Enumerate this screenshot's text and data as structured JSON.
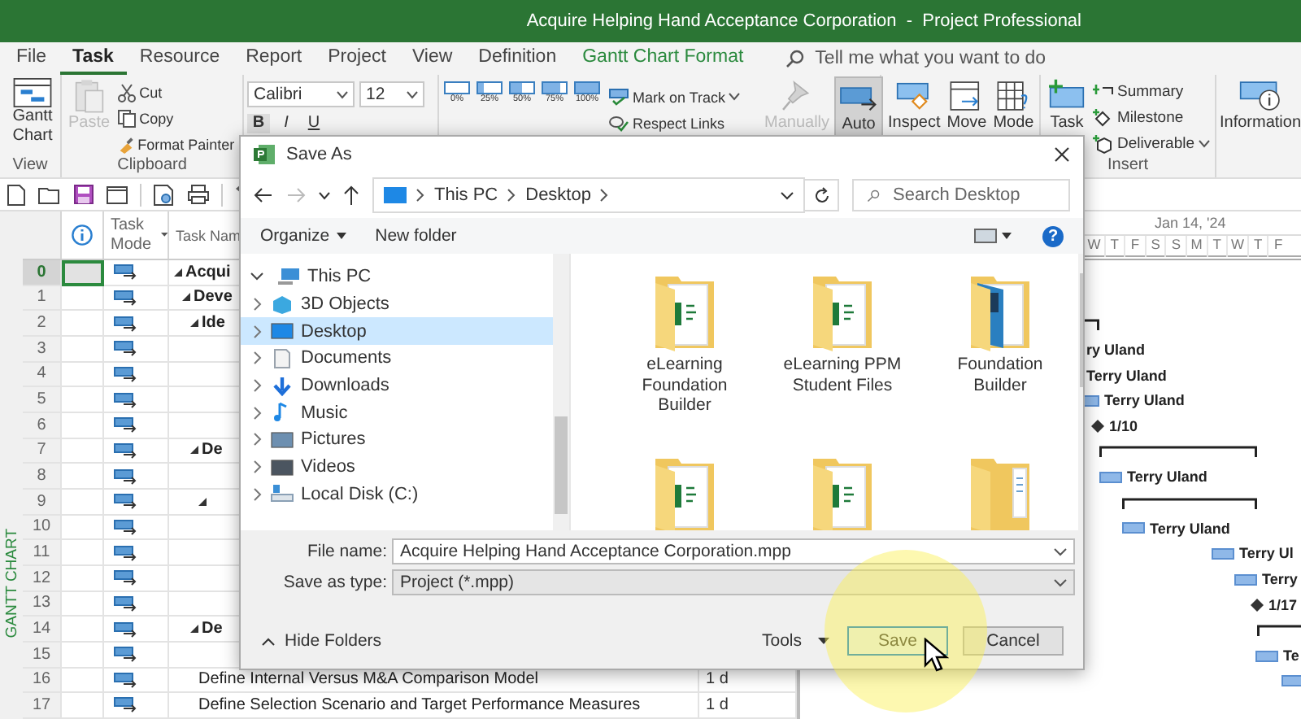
{
  "window": {
    "title": "Acquire Helping Hand Acceptance Corporation  -  Project Professional"
  },
  "menu_tabs": [
    {
      "label": "File",
      "selected": false,
      "kind": "plain"
    },
    {
      "label": "Task",
      "selected": true,
      "kind": "plain"
    },
    {
      "label": "Resource",
      "selected": false,
      "kind": "plain"
    },
    {
      "label": "Report",
      "selected": false,
      "kind": "plain"
    },
    {
      "label": "Project",
      "selected": false,
      "kind": "plain"
    },
    {
      "label": "View",
      "selected": false,
      "kind": "plain"
    },
    {
      "label": "Definition",
      "selected": false,
      "kind": "plain"
    },
    {
      "label": "Gantt Chart Format",
      "selected": false,
      "kind": "contextual"
    }
  ],
  "search": {
    "placeholder": "Tell me what you want to do"
  },
  "ribbon": {
    "view": {
      "button": "Gantt Chart",
      "label": "View"
    },
    "clipboard": {
      "paste": {
        "label": "Paste",
        "disabled": true
      },
      "cut": "Cut",
      "copy": "Copy",
      "format_painter": "Format Painter",
      "label": "Clipboard"
    },
    "font": {
      "name": "Calibri",
      "size": "12",
      "format_buttons": [
        "B",
        "I",
        "U"
      ]
    },
    "schedule": {
      "percent_buttons": [
        "0%",
        "25%",
        "50%",
        "75%",
        "100%"
      ],
      "mark_on_track": "Mark on Track",
      "respect_links": "Respect Links"
    },
    "tasks": [
      {
        "label": "Manually",
        "disabled": true,
        "selected": false
      },
      {
        "label": "Auto",
        "disabled": false,
        "selected": true
      }
    ],
    "task_tools": [
      "Inspect",
      "Move",
      "Mode"
    ],
    "insert": {
      "task": "Task",
      "summary": "Summary",
      "milestone": "Milestone",
      "deliverable": "Deliverable",
      "label": "Insert"
    },
    "properties": {
      "information": "Information"
    }
  },
  "grid": {
    "side_label": "GANTT CHART",
    "columns": [
      "Task Mode",
      "Task Nam"
    ],
    "rows": [
      {
        "id": "0",
        "name": "Acqui",
        "selected": true,
        "expanded": true,
        "children": [
          {
            "id": "1",
            "name": "Deve",
            "selected": false,
            "expanded": true,
            "children": [
              {
                "id": "2",
                "name": "Ide",
                "selected": false,
                "expanded": true,
                "children": [
                  {
                    "id": "3",
                    "selected": false
                  },
                  {
                    "id": "4",
                    "selected": false
                  },
                  {
                    "id": "5",
                    "selected": false
                  },
                  {
                    "id": "6",
                    "selected": false
                  }
                ]
              },
              {
                "id": "7",
                "name": "De",
                "selected": false,
                "expanded": true,
                "children": [
                  {
                    "id": "8",
                    "selected": false
                  },
                  {
                    "id": "9",
                    "selected": false,
                    "expanded": true,
                    "children": [
                      {
                        "id": "10",
                        "selected": false
                      },
                      {
                        "id": "11",
                        "selected": false
                      },
                      {
                        "id": "12",
                        "selected": false
                      },
                      {
                        "id": "13",
                        "selected": false
                      }
                    ]
                  }
                ]
              },
              {
                "id": "14",
                "name": "De",
                "selected": false,
                "expanded": true,
                "children": [
                  {
                    "id": "15",
                    "selected": false
                  },
                  {
                    "id": "16",
                    "name": "Define Internal Versus M&A Comparison Model",
                    "duration": "1 d",
                    "selected": false
                  },
                  {
                    "id": "17",
                    "name": "Define Selection Scenario and Target Performance Measures",
                    "duration": "1 d",
                    "selected": false
                  }
                ]
              }
            ]
          }
        ]
      }
    ]
  },
  "gantt": {
    "timescale_label": "Jan 14, '24",
    "days": [
      "W",
      "T",
      "F",
      "S",
      "S",
      "M",
      "T",
      "W",
      "T",
      "F"
    ],
    "items": [
      {
        "kind": "summary"
      },
      {
        "kind": "task",
        "label": "ry Uland"
      },
      {
        "kind": "task",
        "label": "Terry Uland"
      },
      {
        "kind": "task",
        "label": "Terry Uland"
      },
      {
        "kind": "milestone",
        "label": "1/10"
      },
      {
        "kind": "summary"
      },
      {
        "kind": "task",
        "label": "Terry Uland"
      },
      {
        "kind": "summary"
      },
      {
        "kind": "task",
        "label": "Terry Uland"
      },
      {
        "kind": "task",
        "label": "Terry Ul"
      },
      {
        "kind": "task",
        "label": "Terry"
      },
      {
        "kind": "milestone",
        "label": "1/17"
      },
      {
        "kind": "summary"
      },
      {
        "kind": "task",
        "label": "Te"
      },
      {
        "kind": "task"
      }
    ]
  },
  "dialog": {
    "title": "Save As",
    "breadcrumb": [
      "This PC",
      "Desktop"
    ],
    "search_placeholder": "Search Desktop",
    "toolbar": {
      "organize": "Organize",
      "new_folder": "New folder",
      "help": "?"
    },
    "nav": [
      {
        "label": "This PC",
        "kind": "pc",
        "expanded": true,
        "selected": false,
        "children": [
          {
            "label": "3D Objects",
            "kind": "cube",
            "expanded": false,
            "selected": false
          },
          {
            "label": "Desktop",
            "kind": "desktop",
            "expanded": false,
            "selected": true
          },
          {
            "label": "Documents",
            "kind": "documents",
            "expanded": false,
            "selected": false
          },
          {
            "label": "Downloads",
            "kind": "downloads",
            "expanded": false,
            "selected": false
          },
          {
            "label": "Music",
            "kind": "music",
            "expanded": false,
            "selected": false
          },
          {
            "label": "Pictures",
            "kind": "pictures",
            "expanded": false,
            "selected": false
          },
          {
            "label": "Videos",
            "kind": "videos",
            "expanded": false,
            "selected": false
          },
          {
            "label": "Local Disk (C:)",
            "kind": "disk",
            "expanded": false,
            "selected": false
          }
        ]
      }
    ],
    "files": [
      {
        "name": "eLearning Foundation Builder",
        "kind": "doc-folder"
      },
      {
        "name": "eLearning PPM Student Files",
        "kind": "doc-folder"
      },
      {
        "name": "Foundation Builder",
        "kind": "cover-folder"
      },
      {
        "kind": "doc-folder"
      },
      {
        "kind": "doc-folder"
      },
      {
        "kind": "plain-folder"
      }
    ],
    "file_name_label": "File name:",
    "file_name": "Acquire Helping Hand Acceptance Corporation.mpp",
    "type_label": "Save as type:",
    "type_value": "Project (*.mpp)",
    "hide_folders": "Hide Folders",
    "tools": "Tools",
    "buttons": [
      {
        "label": "Save",
        "kind": "primary"
      },
      {
        "label": "Cancel",
        "kind": "secondary"
      }
    ]
  }
}
